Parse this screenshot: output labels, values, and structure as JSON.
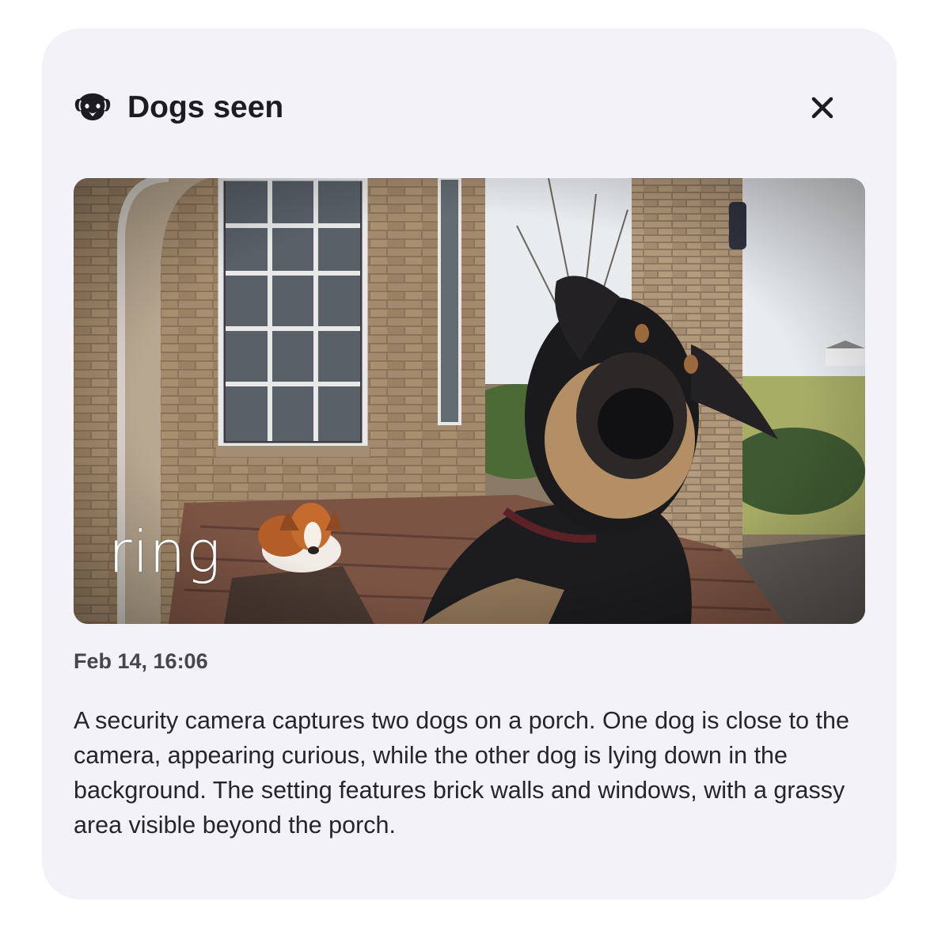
{
  "notification": {
    "title": "Dogs seen",
    "icon": "dog-face-icon",
    "close_icon": "close-icon",
    "snapshot": {
      "brand_watermark": "ring"
    },
    "timestamp": "Feb 14, 16:06",
    "description": "A security camera captures two dogs on a porch. One dog is close to the camera, appearing curious, while the other dog is lying down in the background. The setting features brick walls and windows, with a grassy area visible beyond the porch."
  },
  "colors": {
    "card_background": "#f2f2f8",
    "title_text": "#1c1c22",
    "timestamp_text": "#46464f",
    "body_text": "#25252c"
  }
}
